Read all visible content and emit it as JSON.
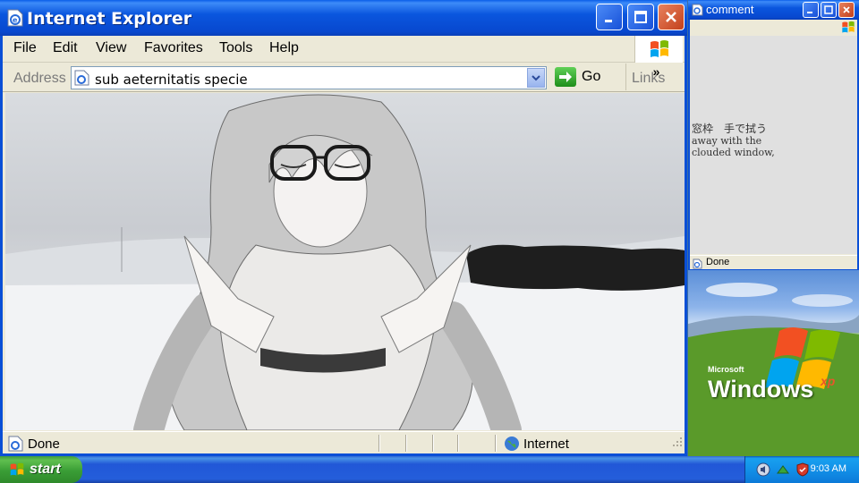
{
  "ie_window": {
    "title": "Internet Explorer",
    "menu": [
      "File",
      "Edit",
      "View",
      "Favorites",
      "Tools",
      "Help"
    ],
    "address_label": "Address",
    "address_value": "sub aeternitatis specie",
    "go_label": "Go",
    "links_label": "Links",
    "status_text": "Done",
    "zone_text": "Internet"
  },
  "comment_window": {
    "title": "comment",
    "poem_lines": [
      "窓枠　手で拭う",
      "away with the",
      "clouded window,"
    ],
    "status_text": "Done"
  },
  "desktop": {
    "brand_small": "Microsoft",
    "brand_large": "Windows",
    "brand_suffix": "xp"
  },
  "taskbar": {
    "start_label": "start",
    "clock": "9:03 AM"
  },
  "colors": {
    "xp_blue": "#0a4fd6",
    "start_green": "#3a9d36",
    "chrome": "#ece9d8"
  }
}
